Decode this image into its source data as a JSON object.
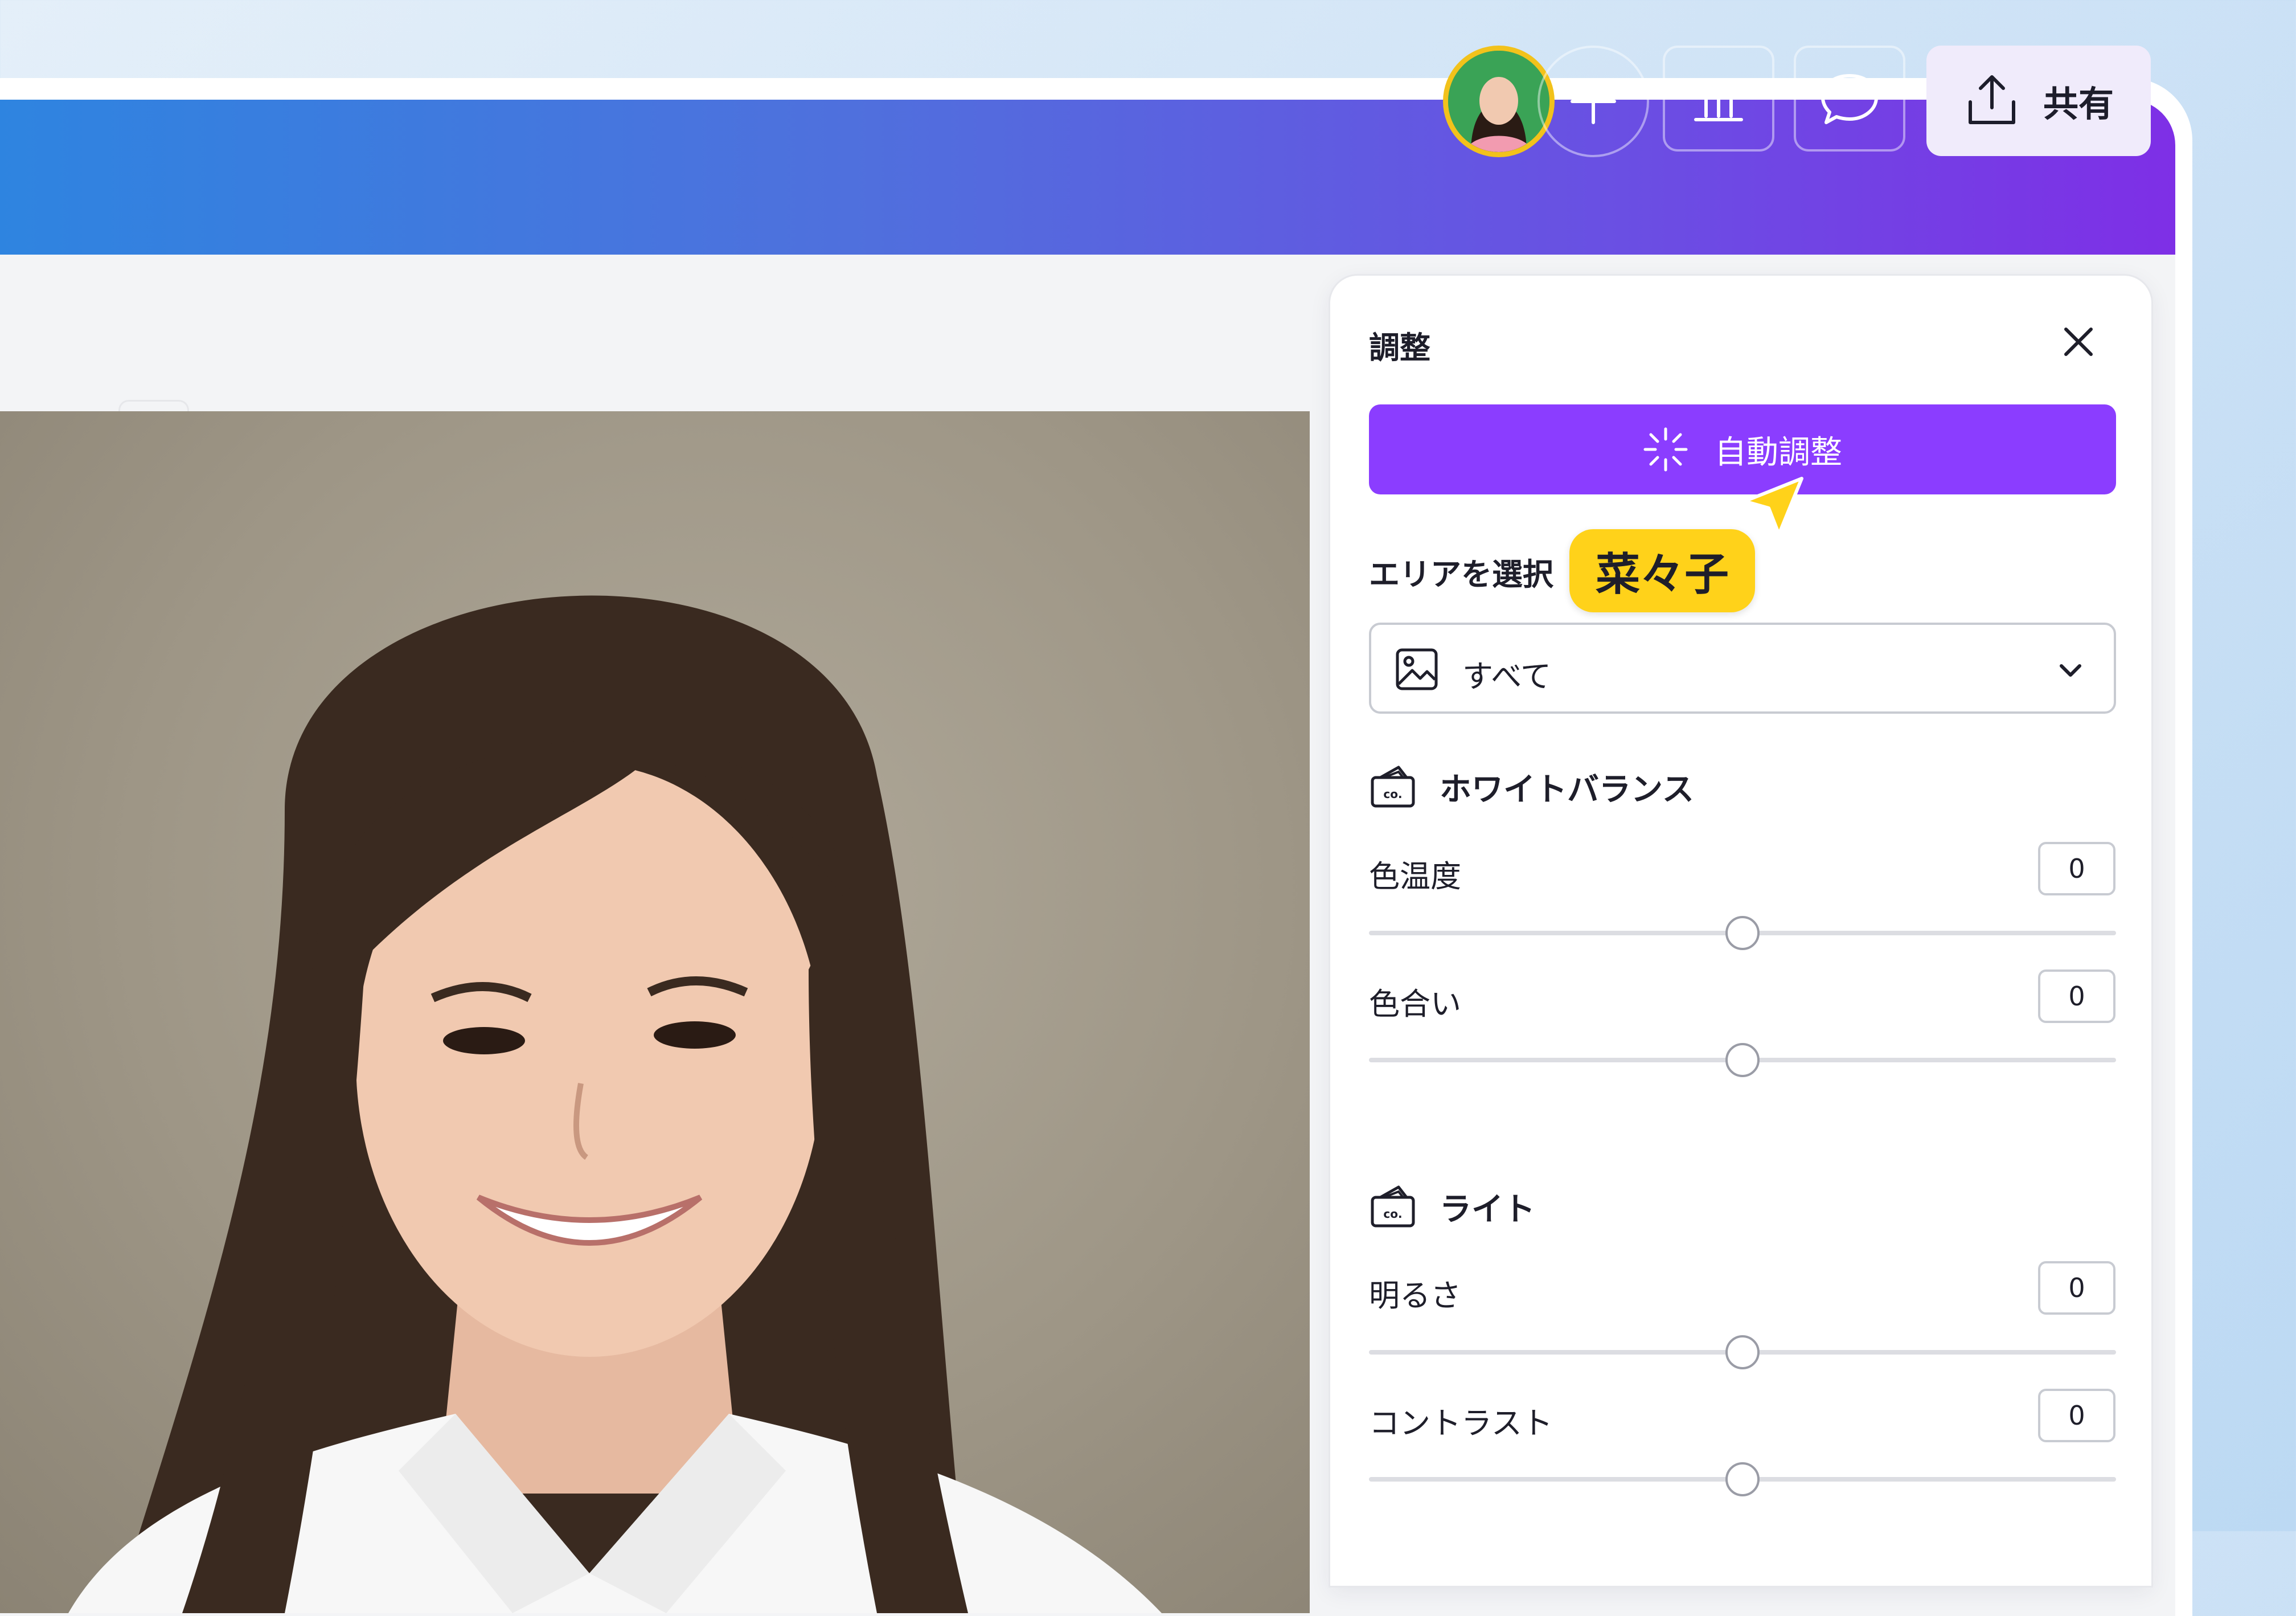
{
  "topbar": {
    "share_label": "共有",
    "icons": [
      "avatar",
      "plus-icon",
      "insights-icon",
      "comment-icon",
      "share-upload-icon"
    ]
  },
  "panel": {
    "title": "調整",
    "auto_adjust_label": "自動調整",
    "area_label": "エリアを選択",
    "area_select_value": "すべて",
    "white_balance": {
      "title": "ホワイトバランス",
      "controls": [
        {
          "label": "色温度",
          "value": "0"
        },
        {
          "label": "色合い",
          "value": "0"
        }
      ]
    },
    "light": {
      "title": "ライト",
      "controls": [
        {
          "label": "明るさ",
          "value": "0"
        },
        {
          "label": "コントラスト",
          "value": "0"
        }
      ]
    }
  },
  "collaborator_cursor": {
    "name": "菜々子"
  },
  "colors": {
    "accent": "#8b3dff",
    "topbar_start": "#2d85e0",
    "topbar_end": "#7e2fe6",
    "cursor_tag": "#ffd21a",
    "avatar_ring": "#f2c21b"
  }
}
